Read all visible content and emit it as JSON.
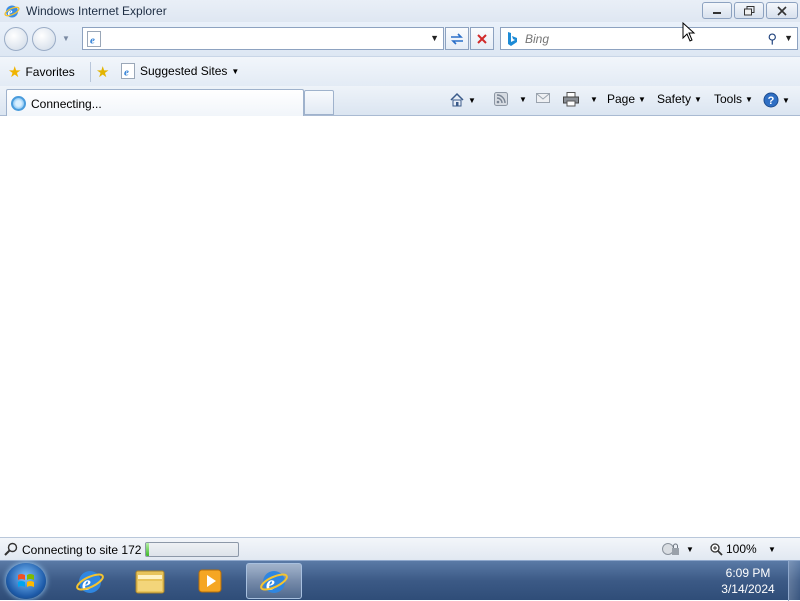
{
  "window": {
    "title": "Windows Internet Explorer",
    "minimize_icon": "minimize-icon",
    "restore_icon": "restore-icon",
    "close_icon": "close-icon"
  },
  "address_bar": {
    "value": "",
    "refresh_icon": "refresh-icon",
    "stop_icon": "stop-icon"
  },
  "search": {
    "placeholder": "Bing",
    "provider_icon": "bing-icon"
  },
  "favorites_bar": {
    "favorites_label": "Favorites",
    "suggested_sites_label": "Suggested Sites"
  },
  "tab": {
    "label": "Connecting..."
  },
  "command_bar": {
    "page_label": "Page",
    "safety_label": "Safety",
    "tools_label": "Tools"
  },
  "status_bar": {
    "text": "Connecting to site 172",
    "progress_fraction": 0.03,
    "zoom": "100%"
  },
  "taskbar": {
    "time": "6:09 PM",
    "date": "3/14/2024",
    "apps": [
      "internet-explorer",
      "windows-explorer",
      "media-player",
      "internet-explorer-active"
    ]
  },
  "colors": {
    "accent": "#3c5a86",
    "progress": "#3fba2b"
  }
}
